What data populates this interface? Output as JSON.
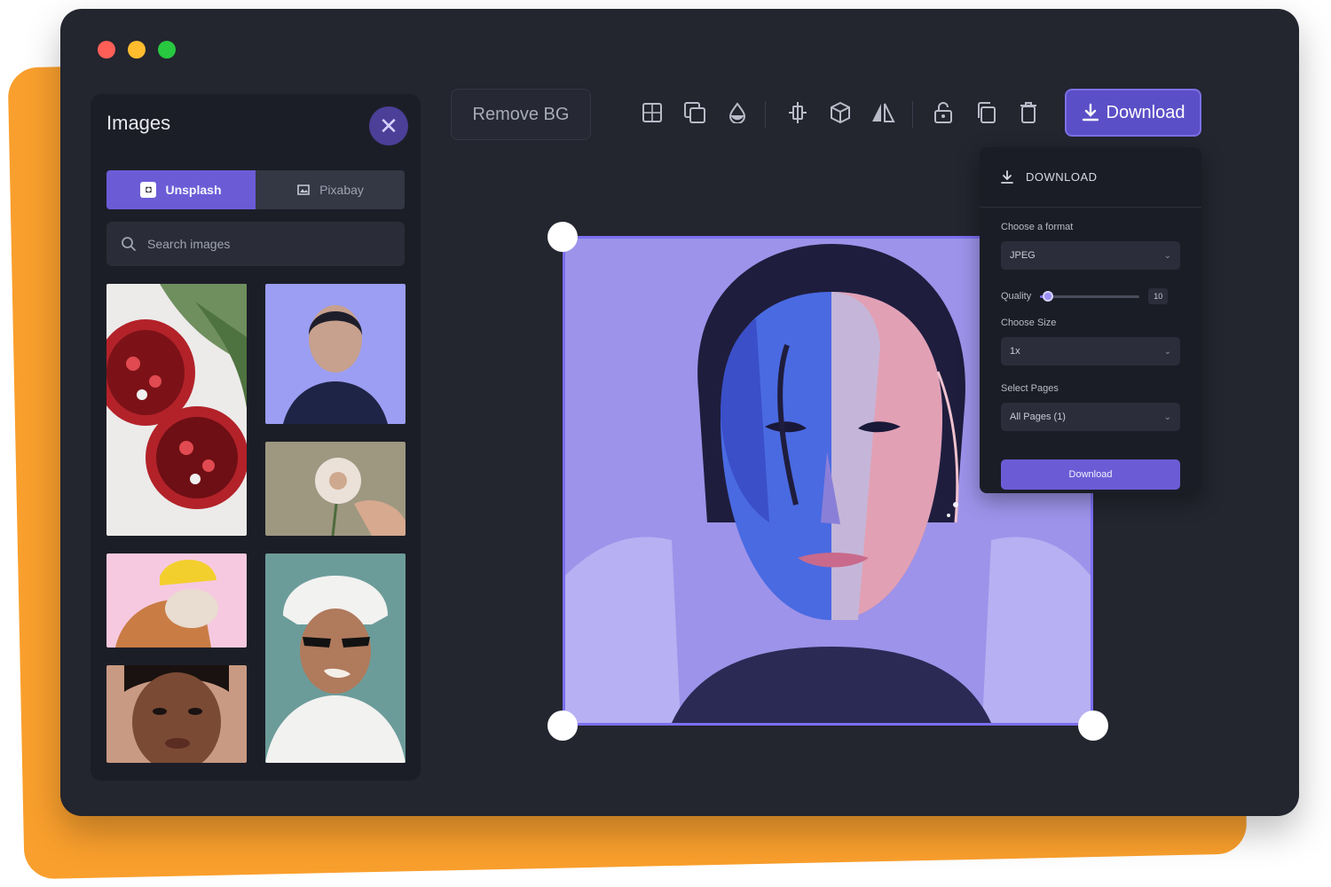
{
  "window": {
    "traffic_lights": [
      "#ff5f57",
      "#febc2e",
      "#28c840"
    ]
  },
  "images_panel": {
    "title": "Images",
    "tabs": [
      {
        "label": "Unsplash",
        "icon": "unsplash-icon",
        "active": true
      },
      {
        "label": "Pixabay",
        "icon": "pixabay-icon",
        "active": false
      }
    ],
    "search": {
      "placeholder": "Search images",
      "value": ""
    }
  },
  "toolbar": {
    "remove_bg_label": "Remove BG",
    "tools": [
      "grid-icon",
      "duplicate-frame-icon",
      "opacity-icon",
      "align-center-icon",
      "layers-3d-icon",
      "flip-icon",
      "unlock-icon",
      "copy-icon",
      "trash-icon"
    ],
    "download_label": "Download"
  },
  "download_panel": {
    "title": "DOWNLOAD",
    "format_label": "Choose a format",
    "format_value": "JPEG",
    "quality_label": "Quality",
    "quality_value": "10",
    "quality_level": 0.08,
    "size_label": "Choose Size",
    "size_value": "1x",
    "pages_label": "Select Pages",
    "pages_value": "All Pages (1)",
    "submit_label": "Download"
  },
  "colors": {
    "accent": "#6b5cd6",
    "window_bg": "#23252f",
    "panel_bg": "#1c1e27",
    "orange": "#f99f2d"
  }
}
